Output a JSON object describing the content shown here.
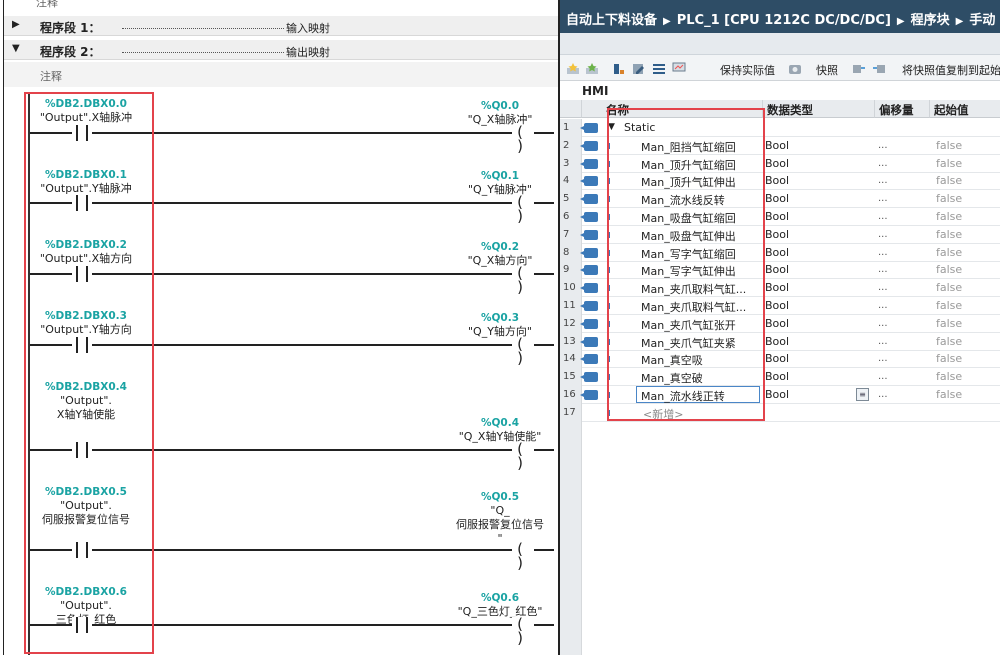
{
  "lad": {
    "top_label": "注释",
    "networks": [
      {
        "label": "程序段 1：",
        "title": "输入映射",
        "expanded": false
      },
      {
        "label": "程序段 2：",
        "title": "输出映射",
        "expanded": true
      }
    ],
    "comment": "注释",
    "rungs": [
      {
        "contact_addr": "%DB2.DBX0.0",
        "contact_name": [
          "\"Output\".X轴脉冲"
        ],
        "coil_addr": "%Q0.0",
        "coil_name": [
          "\"Q_X轴脉冲\""
        ]
      },
      {
        "contact_addr": "%DB2.DBX0.1",
        "contact_name": [
          "\"Output\".Y轴脉冲"
        ],
        "coil_addr": "%Q0.1",
        "coil_name": [
          "\"Q_Y轴脉冲\""
        ]
      },
      {
        "contact_addr": "%DB2.DBX0.2",
        "contact_name": [
          "\"Output\".X轴方向"
        ],
        "coil_addr": "%Q0.2",
        "coil_name": [
          "\"Q_X轴方向\""
        ]
      },
      {
        "contact_addr": "%DB2.DBX0.3",
        "contact_name": [
          "\"Output\".Y轴方向"
        ],
        "coil_addr": "%Q0.3",
        "coil_name": [
          "\"Q_Y轴方向\""
        ]
      },
      {
        "contact_addr": "%DB2.DBX0.4",
        "contact_name": [
          "\"Output\".",
          "X轴Y轴使能"
        ],
        "coil_addr": "%Q0.4",
        "coil_name": [
          "\"Q_X轴Y轴使能\""
        ]
      },
      {
        "contact_addr": "%DB2.DBX0.5",
        "contact_name": [
          "\"Output\".",
          "伺服报警复位信号"
        ],
        "coil_addr": "%Q0.5",
        "coil_name": [
          "\"Q_",
          "伺服报警复位信号",
          "\""
        ]
      },
      {
        "contact_addr": "%DB2.DBX0.6",
        "contact_name": [
          "\"Output\".",
          "三色灯_红色"
        ],
        "coil_addr": "%Q0.6",
        "coil_name": [
          "\"Q_三色灯_红色\""
        ]
      }
    ]
  },
  "db": {
    "breadcrumb": [
      "自动上下料设备",
      "PLC_1 [CPU 1212C DC/DC/DC]",
      "程序块",
      "手动"
    ],
    "toolbar": {
      "keep_actual": "保持实际值",
      "snapshot": "快照",
      "copy_snapshot": "将快照值复制到起始"
    },
    "db_name": "HMI",
    "columns": [
      "名称",
      "数据类型",
      "偏移量",
      "起始值"
    ],
    "rows": [
      {
        "num": "1",
        "name": "Static",
        "type": "",
        "offset": "",
        "init": "",
        "kind": "static"
      },
      {
        "num": "2",
        "name": "Man_阻挡气缸缩回",
        "type": "Bool",
        "offset": "...",
        "init": "false"
      },
      {
        "num": "3",
        "name": "Man_顶升气缸缩回",
        "type": "Bool",
        "offset": "...",
        "init": "false"
      },
      {
        "num": "4",
        "name": "Man_顶升气缸伸出",
        "type": "Bool",
        "offset": "...",
        "init": "false"
      },
      {
        "num": "5",
        "name": "Man_流水线反转",
        "type": "Bool",
        "offset": "...",
        "init": "false"
      },
      {
        "num": "6",
        "name": "Man_吸盘气缸缩回",
        "type": "Bool",
        "offset": "...",
        "init": "false"
      },
      {
        "num": "7",
        "name": "Man_吸盘气缸伸出",
        "type": "Bool",
        "offset": "...",
        "init": "false"
      },
      {
        "num": "8",
        "name": "Man_写字气缸缩回",
        "type": "Bool",
        "offset": "...",
        "init": "false"
      },
      {
        "num": "9",
        "name": "Man_写字气缸伸出",
        "type": "Bool",
        "offset": "...",
        "init": "false"
      },
      {
        "num": "10",
        "name": "Man_夹爪取料气缸...",
        "type": "Bool",
        "offset": "...",
        "init": "false"
      },
      {
        "num": "11",
        "name": "Man_夹爪取料气缸...",
        "type": "Bool",
        "offset": "...",
        "init": "false"
      },
      {
        "num": "12",
        "name": "Man_夹爪气缸张开",
        "type": "Bool",
        "offset": "...",
        "init": "false"
      },
      {
        "num": "13",
        "name": "Man_夹爪气缸夹紧",
        "type": "Bool",
        "offset": "...",
        "init": "false"
      },
      {
        "num": "14",
        "name": "Man_真空吸",
        "type": "Bool",
        "offset": "...",
        "init": "false"
      },
      {
        "num": "15",
        "name": "Man_真空破",
        "type": "Bool",
        "offset": "...",
        "init": "false"
      },
      {
        "num": "16",
        "name": "Man_流水线正转",
        "type": "Bool",
        "offset": "...",
        "init": "false",
        "selected": true
      },
      {
        "num": "17",
        "name": "<新增>",
        "type": "",
        "offset": "",
        "init": "",
        "kind": "add"
      }
    ]
  },
  "colors": {
    "highlight_box": "#e3434b",
    "address": "#1aa3a3",
    "title_bar": "#2e4d66",
    "member_icon": "#3b79b8"
  }
}
